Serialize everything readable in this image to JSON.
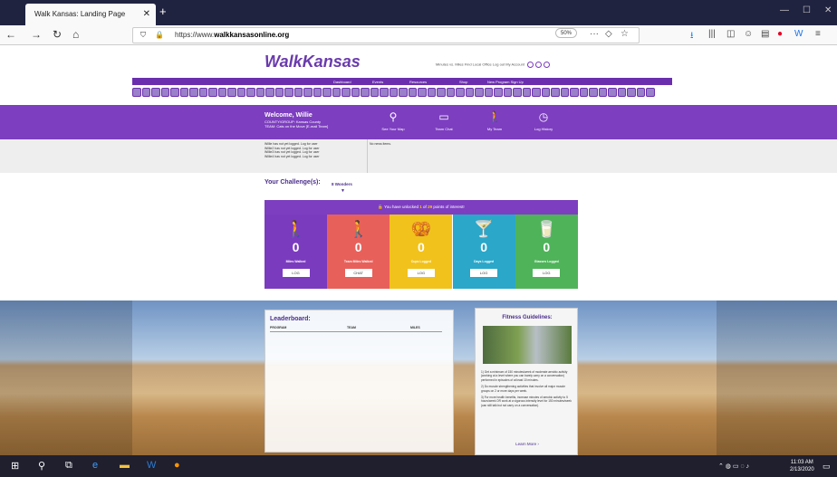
{
  "browser": {
    "tab_title": "Walk Kansas: Landing Page",
    "url_prefix": "https://www.",
    "url_domain": "walkkansasonline.org",
    "zoom": "50%"
  },
  "site": {
    "logo_text_1": "Walk",
    "logo_text_2": "Kansas",
    "toplinks": "Minutes vs. Miles   Find Local Office   Log out   My Account",
    "nav": [
      "Dashboard",
      "Events",
      "Resources",
      "Shop",
      "New Program Sign Up"
    ],
    "welcome": {
      "name": "Welcome, Willie",
      "sub_1": "COUNTY/GROUP: Kansas County",
      "sub_2": "TEAM:          Cats on the Move   [E-mail Team]"
    },
    "quick_icons": [
      "See Your Map",
      "Team Chat",
      "My Team",
      "Log History"
    ],
    "log_lines": [
      "Willie has not yet logged. Log for user",
      "Willie2 has not yet logged. Log for user",
      "Willie3 has not yet logged. Log for user",
      "Willie4 has not yet logged. Log for user"
    ],
    "news": "No news items.",
    "challenge_label": "Your Challenge(s):",
    "challenge_selected": "8 Wonders",
    "unlock_pre": "You have unlocked ",
    "unlock_count": "1",
    "unlock_mid": " of ",
    "unlock_total": "29",
    "unlock_post": " points of interest!",
    "cards": [
      {
        "value": "0",
        "label": "Miles Walked",
        "button": "LOG",
        "color": "#7b3bbf"
      },
      {
        "value": "0",
        "label": "Team Miles Walked",
        "button": "CHAT",
        "color": "#e8605a"
      },
      {
        "value": "0",
        "label": "Cups Logged",
        "button": "LOG",
        "color": "#f2c21c"
      },
      {
        "value": "0",
        "label": "Days Logged",
        "button": "LOG",
        "color": "#2aa7c9"
      },
      {
        "value": "0",
        "label": "Glasses Logged",
        "button": "LOG",
        "color": "#4fb35a"
      }
    ],
    "leaderboard": {
      "title": "Leaderboard:",
      "col_program": "PROGRAM",
      "col_team": "TEAM",
      "col_miles": "MILES"
    },
    "fitness": {
      "title": "Fitness Guidelines:",
      "p1": "1) Get a minimum of 150 minutes/week of moderate aerobic activity (working at a level where you can barely carry on a conversation) performed in episodes of at least 10 minutes.",
      "p2": "2) Do muscle strengthening activities that involve all major muscle groups on 2 or more days per week.",
      "p3": "3) For more health benefits, increase minutes of aerobic activity to 5 hours/week OR work at a vigorous intensity level for 150 minutes/week (can still talk but not carry on a conversation).",
      "more": "Learn More ›"
    }
  },
  "taskbar": {
    "time": "11:03 AM",
    "date": "2/13/2020"
  }
}
